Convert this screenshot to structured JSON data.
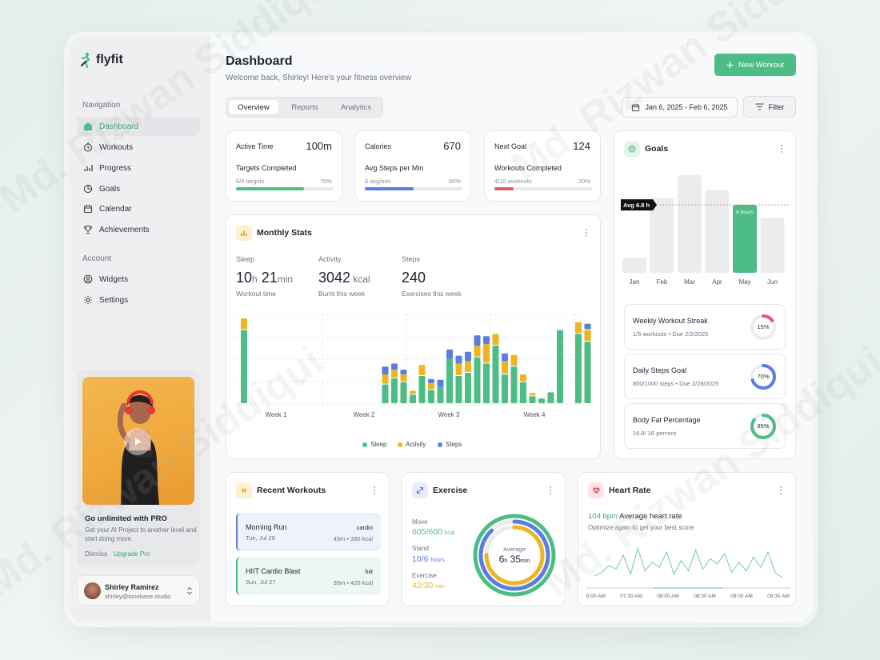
{
  "brand": {
    "name": "flyfit",
    "accent": "#4cbd84"
  },
  "sidebar": {
    "nav_heading": "Navigation",
    "nav_items": [
      {
        "label": "Dashboard",
        "icon": "home-icon",
        "active": true
      },
      {
        "label": "Workouts",
        "icon": "stopwatch-icon"
      },
      {
        "label": "Progress",
        "icon": "bar-chart-icon"
      },
      {
        "label": "Goals",
        "icon": "pie-chart-icon"
      },
      {
        "label": "Calendar",
        "icon": "calendar-icon"
      },
      {
        "label": "Achievements",
        "icon": "trophy-icon"
      }
    ],
    "account_heading": "Account",
    "account_items": [
      {
        "label": "Widgets",
        "icon": "user-circle-icon"
      },
      {
        "label": "Settings",
        "icon": "gear-icon"
      }
    ],
    "promo": {
      "title": "Go unlimited with PRO",
      "text": "Get your AI Project to another level and start doing more.",
      "dismiss": "Dismiss",
      "upgrade": "Upgrade Pro"
    },
    "user": {
      "name": "Shirley Ramirez",
      "email": "shirley@tonebase.studio"
    }
  },
  "header": {
    "title": "Dashboard",
    "subtitle": "Welcome back, Shirley! Here's your fitness overview",
    "new_workout": "New Workout",
    "tabs": [
      "Overview",
      "Reports",
      "Analytics"
    ],
    "date_range": "Jan 6, 2025 - Feb 6, 2025",
    "filter": "Filter"
  },
  "kpis": [
    {
      "label": "Active Time",
      "value": "100m",
      "sub": "Targets Completed",
      "small": "6/9 targets",
      "pct": "70%",
      "progress": 0.7,
      "color": "#4cbd84"
    },
    {
      "label": "Calories",
      "value": "670",
      "sub": "Avg Steps per Min",
      "small": "6 avg/min",
      "pct": "50%",
      "progress": 0.5,
      "color": "#5a7de0"
    },
    {
      "label": "Next Goal",
      "value": "124",
      "sub": "Workouts Completed",
      "small": "4/10 workouts",
      "pct": "20%",
      "progress": 0.2,
      "color": "#e55a6d"
    }
  ],
  "monthly": {
    "title": "Monthly Stats",
    "stats": [
      {
        "label": "Sleep",
        "big1": "10",
        "unit1": "h",
        "big2": "21",
        "unit2": "min",
        "foot": "Workout time"
      },
      {
        "label": "Activity",
        "big1": "3042",
        "unit1": " kcal",
        "foot": "Burnt this week"
      },
      {
        "label": "Steps",
        "big1": "240",
        "foot": "Exercises this week"
      }
    ]
  },
  "goals": {
    "title": "Goals",
    "avg_label": "Avg 6.8 h",
    "items": [
      {
        "title": "Weekly Workout Streak",
        "sub": "1/5 workouts • Due 2/2/2025",
        "pct": "15%",
        "progress": 0.15,
        "color": "#e55a6d"
      },
      {
        "title": "Daily Steps Goal",
        "sub": "850/1000 steps • Due 2/28/2025",
        "pct": "70%",
        "progress": 0.7,
        "color": "#5a7de0"
      },
      {
        "title": "Body Fat Percentage",
        "sub": "16.8/ 16 percent",
        "pct": "85%",
        "progress": 0.85,
        "color": "#4cbd84"
      }
    ]
  },
  "recent": {
    "title": "Recent Workouts",
    "items": [
      {
        "name": "Morning Run",
        "date": "Tue, Jul 29",
        "type": "cardio",
        "meta": "45m • 380 kcal"
      },
      {
        "name": "HIIT Cardio Blast",
        "date": "Sun, Jul 27",
        "type": "hiit",
        "meta": "35m • 420 kcal"
      }
    ]
  },
  "exercise": {
    "title": "Exercise",
    "rows": [
      {
        "label": "Move",
        "value": "605/600",
        "unit": "kcal",
        "color": "#4cbd84",
        "progress": 1.0
      },
      {
        "label": "Stand",
        "value": "10/6",
        "unit": "hours",
        "color": "#5a7de0",
        "progress": 0.88
      },
      {
        "label": "Exercise",
        "value": "42/30",
        "unit": "min",
        "color": "#efb421",
        "progress": 0.75
      }
    ],
    "center_label": "Average",
    "center_h": "6",
    "center_h_unit": "h",
    "center_m": "35",
    "center_m_unit": "min"
  },
  "heart": {
    "title": "Heart Rate",
    "bpm": "104 bpm",
    "bpm_label": "Average heart rate",
    "sub": "Optimize again to get your best score"
  },
  "chart_data": [
    {
      "type": "bar",
      "stacked": true,
      "title": "Monthly Stats",
      "categories": [
        "Week 1",
        "",
        "",
        "",
        "",
        "",
        "",
        "",
        "Week 2",
        "",
        "",
        "",
        "",
        "",
        "",
        "",
        "Week 3",
        "",
        "",
        "",
        "",
        "",
        "",
        "",
        "Week 4",
        "",
        "",
        ""
      ],
      "series": [
        {
          "name": "Sleep",
          "color": "#4cbd84",
          "values": [
            9.5,
            0,
            0,
            0,
            0,
            0,
            0,
            0,
            2.5,
            3.3,
            2.8,
            1.2,
            3.6,
            1.8,
            2.2,
            5.8,
            3.6,
            4.0,
            6.0,
            5.2,
            7.5,
            3.8,
            4.8,
            2.8,
            1.0,
            0.7,
            1.5,
            9.5
          ]
        },
        {
          "name": "Activity",
          "color": "#efb421",
          "values": [
            1.5,
            0,
            0,
            0,
            0,
            0,
            0,
            0,
            1.3,
            1.1,
            1.0,
            0.5,
            1.4,
            0.9,
            0,
            0,
            1.6,
            1.5,
            1.5,
            2.5,
            1.5,
            1.7,
            1.5,
            1.0,
            0.4,
            0,
            0,
            0
          ]
        },
        {
          "name": "Steps",
          "color": "#5a7de0",
          "values": [
            0,
            0,
            0,
            0,
            0,
            0,
            0,
            0,
            1.0,
            0.8,
            0.6,
            0,
            0,
            0.5,
            0.9,
            1.2,
            1.0,
            1.2,
            1.3,
            1.0,
            0,
            1.0,
            0,
            0,
            0,
            0,
            0,
            0
          ]
        }
      ],
      "tail_bars": {
        "sleep": [
          9.0,
          8.0
        ],
        "activity": [
          1.5,
          1.5
        ],
        "steps": [
          0,
          0.8
        ]
      },
      "xlabels": [
        "Week 1",
        "Week 2",
        "Week 3",
        "Week 4"
      ]
    },
    {
      "type": "bar",
      "title": "Goals",
      "categories": [
        "Jan",
        "Feb",
        "Mar",
        "Apr",
        "May",
        "Jun"
      ],
      "values": [
        1.5,
        7.5,
        9.8,
        8.3,
        6.8,
        5.5
      ],
      "highlight_index": 4,
      "highlight_label": "8 hours",
      "average": 6.8,
      "average_label": "Avg 6.8 h",
      "highlight_color": "#4cbd84"
    },
    {
      "type": "line",
      "title": "Heart Rate",
      "x": [
        "06:00 AM",
        "07:30 AM",
        "08:00 AM",
        "08:30 AM",
        "09:00 AM",
        "09:30 AM"
      ],
      "values": [
        96,
        98,
        102,
        100,
        108,
        97,
        112,
        99,
        104,
        101,
        110,
        97,
        105,
        99,
        111,
        100,
        106,
        103,
        109,
        98,
        104,
        99,
        107,
        101,
        110,
        98,
        95
      ],
      "color": "#76c7a5"
    }
  ]
}
